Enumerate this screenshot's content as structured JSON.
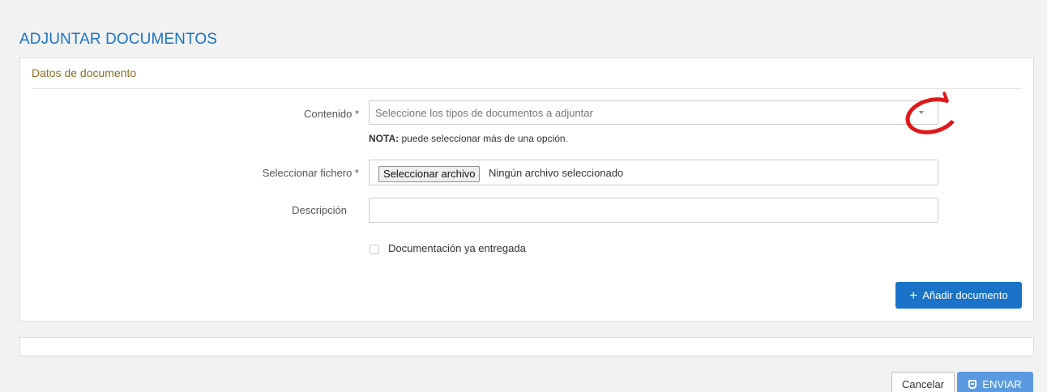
{
  "page": {
    "title": "ADJUNTAR DOCUMENTOS"
  },
  "panel": {
    "heading": "Datos de documento",
    "contenido": {
      "label": "Contenido *",
      "placeholder": "Seleccione los tipos de documentos a adjuntar",
      "note_bold": "NOTA:",
      "note_text": " puede seleccionar más de una opción."
    },
    "fichero": {
      "label": "Seleccionar fichero *",
      "button_label": "Seleccionar archivo",
      "status": "Ningún archivo seleccionado"
    },
    "descripcion": {
      "label": "Descripción",
      "value": ""
    },
    "entregada": {
      "label": "Documentación ya entregada",
      "checked": false
    },
    "add_button": {
      "icon": "plus-icon",
      "label": "Añadir documento"
    }
  },
  "footer": {
    "cancel_label": "Cancelar",
    "send_label": "ENVIAR",
    "send_icon": "shield-icon"
  },
  "colors": {
    "accent": "#1a73c8",
    "heading": "#8a6d1f",
    "annotation": "#e0181b",
    "send_button": "#5b9ae0"
  }
}
